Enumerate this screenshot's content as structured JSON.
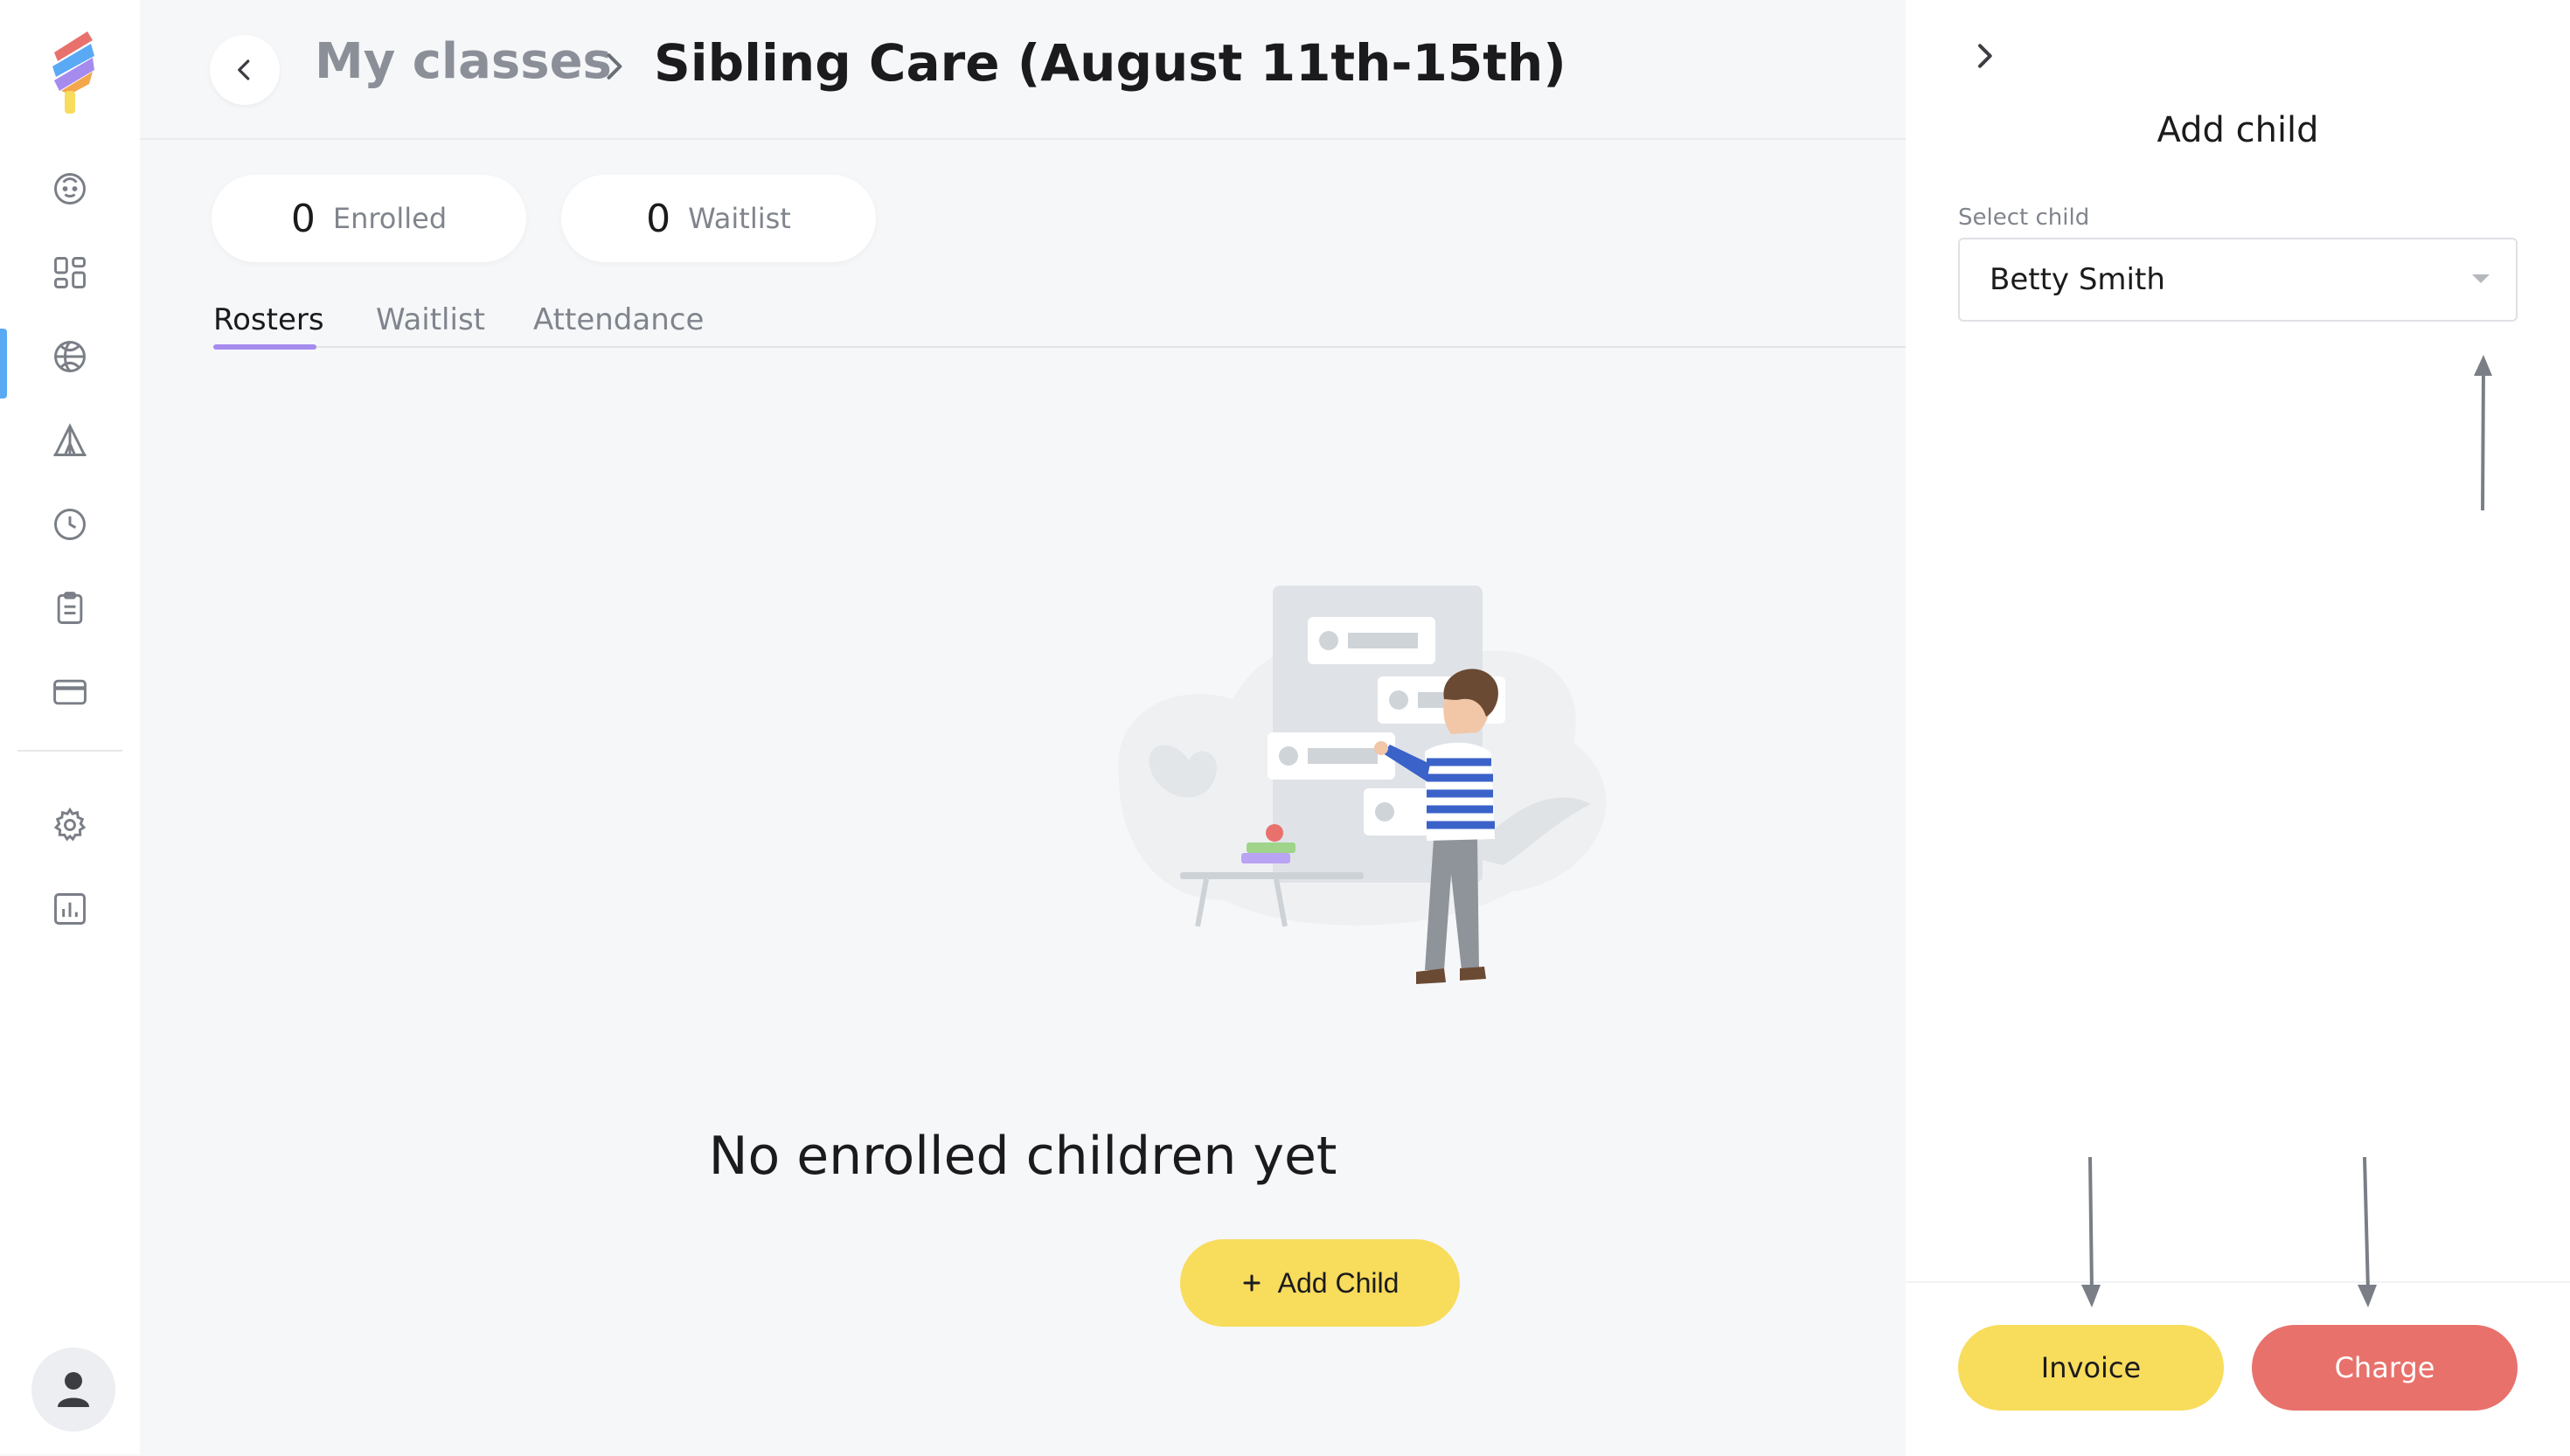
{
  "breadcrumb": {
    "parent": "My classes",
    "current": "Sibling Care (August 11th-15th)"
  },
  "stats": [
    {
      "count": "0",
      "label": "Enrolled"
    },
    {
      "count": "0",
      "label": "Waitlist"
    }
  ],
  "tabs": [
    {
      "label": "Rosters",
      "active": true
    },
    {
      "label": "Waitlist",
      "active": false
    },
    {
      "label": "Attendance",
      "active": false
    }
  ],
  "empty_state": {
    "title": "No enrolled children yet",
    "button_label": "Add Child"
  },
  "sidebar": {
    "items": [
      {
        "icon": "child-face-icon"
      },
      {
        "icon": "dashboard-icon"
      },
      {
        "icon": "activities-icon",
        "active": true
      },
      {
        "icon": "camp-tent-icon"
      },
      {
        "icon": "clock-icon"
      },
      {
        "icon": "clipboard-icon"
      },
      {
        "icon": "credit-card-icon"
      },
      {
        "icon": "gear-icon"
      },
      {
        "icon": "reports-chart-icon"
      }
    ]
  },
  "panel": {
    "title": "Add child",
    "select_label": "Select child",
    "select_value": "Betty Smith",
    "invoice_label": "Invoice",
    "charge_label": "Charge"
  },
  "colors": {
    "accent_yellow": "#f8dc5c",
    "charge_red": "#e8716c",
    "tab_underline": "#a68bee",
    "active_nav": "#5aa9f5"
  }
}
